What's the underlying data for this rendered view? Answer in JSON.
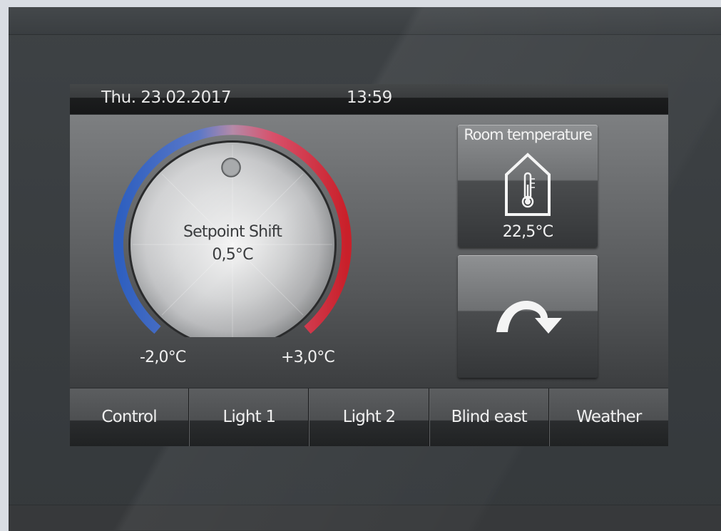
{
  "status": {
    "date": "Thu.  23.02.2017",
    "time": "13:59"
  },
  "knob": {
    "title": "Setpoint Shift",
    "value": "0,5°C",
    "min": "-2,0°C",
    "max": "+3,0°C",
    "cold_color": "#2e5fbf",
    "warm_color": "#c9202a"
  },
  "room": {
    "title": "Room temperature",
    "value": "22,5°C",
    "icon": "house-thermometer-icon"
  },
  "scene": {
    "icon": "curved-arrow-icon"
  },
  "nav": [
    "Control",
    "Light 1",
    "Light 2",
    "Blind east",
    "Weather"
  ]
}
